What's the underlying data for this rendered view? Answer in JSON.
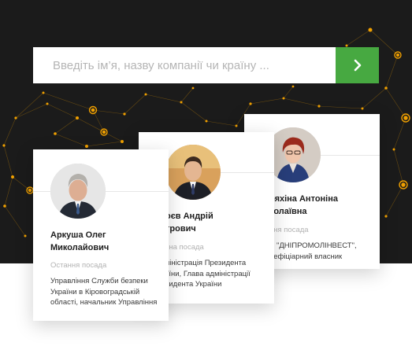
{
  "search": {
    "placeholder": "Введіть ім’я, назву компанії чи країну ..."
  },
  "colors": {
    "accent": "#47a941",
    "network": "#f0a000",
    "background": "#1b1b1b"
  },
  "cards": [
    {
      "name_line1": "Аркуша Олег",
      "name_line2": "Миколайович",
      "position_label": "Остання посада",
      "position_line1": "Управління Служби безпеки",
      "position_line2": "України в Кіровоградській",
      "position_line3": "області, начальник Управління"
    },
    {
      "name_line1": "оєв Андрій",
      "name_line2": "трович",
      "position_label": "зна посада",
      "position_line1": "ніністрація Президента",
      "position_line2": "зїни, Глава адміністрації",
      "position_line3": "зидента України"
    },
    {
      "name_line1": "ряхіна Антоніна",
      "name_line2": "колаївна",
      "position_label": "ння посада",
      "position_line1": "В \"ДНІПРОМОЛІНВЕСТ\",",
      "position_line2": "нефіціарний власник",
      "position_line3": ""
    }
  ]
}
